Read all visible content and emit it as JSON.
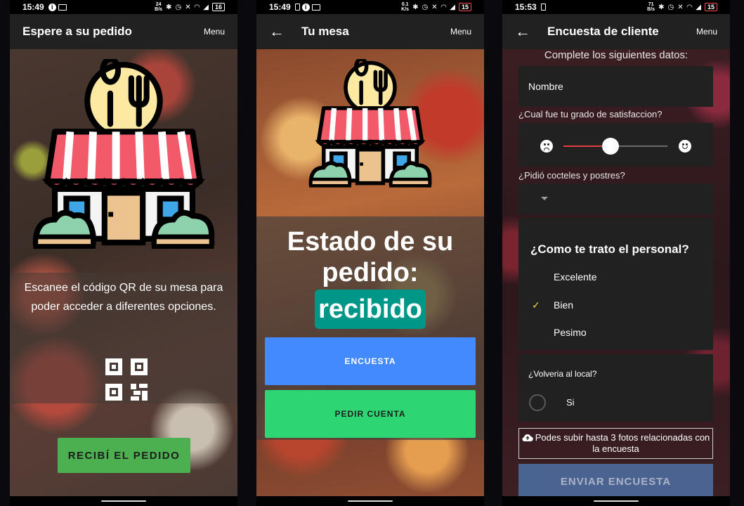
{
  "screens": [
    {
      "statusbar": {
        "time": "15:49",
        "speed_top": "24",
        "speed_bottom": "B/s",
        "battery": "16"
      },
      "appbar": {
        "title": "Espere a su pedido",
        "menu": "Menu"
      },
      "instructions": "Escanee el código QR de su mesa para poder acceder a diferentes opciones.",
      "button_label": "RECIBÍ EL PEDIDO"
    },
    {
      "statusbar": {
        "time": "15:49",
        "speed_top": "0.1",
        "speed_bottom": "K/s",
        "battery": "15"
      },
      "appbar": {
        "title": "Tu mesa",
        "menu": "Menu"
      },
      "status_heading": "Estado de su pedido:",
      "status_value": "recibido",
      "encuesta_button": "ENCUESTA",
      "cuenta_button": "PEDIR CUENTA"
    },
    {
      "statusbar": {
        "time": "15:53",
        "speed_top": "71",
        "speed_bottom": "B/s",
        "battery": "15"
      },
      "appbar": {
        "title": "Encuesta de cliente",
        "menu": "Menu"
      },
      "heading": "Complete los siguientes datos:",
      "nombre_placeholder": "Nombre",
      "satisfaction_label": "¿Cual fue tu grado de satisfaccion?",
      "satisfaction_value": 0.45,
      "postres_label": "¿Pidió cocteles y postres?",
      "trato_question": "¿Como te trato el personal?",
      "trato_options": [
        "Excelente",
        "Bien",
        "Pesimo"
      ],
      "trato_selected": "Bien",
      "volveria_question": "¿Volveria al local?",
      "volveria_option": "Si",
      "upload_text": "Podes subir hasta 3 fotos relacionadas con la encuesta",
      "submit_button": "ENVIAR ENCUESTA"
    }
  ],
  "colors": {
    "appbar": "#212121",
    "recibi_button": "#4caf50",
    "status_badge": "#009688",
    "encuesta_button": "#448aff",
    "cuenta_button": "#2ed573",
    "slider_fill": "#e53945",
    "check": "#ffd740",
    "enviar_button": "#4d6b9e"
  }
}
